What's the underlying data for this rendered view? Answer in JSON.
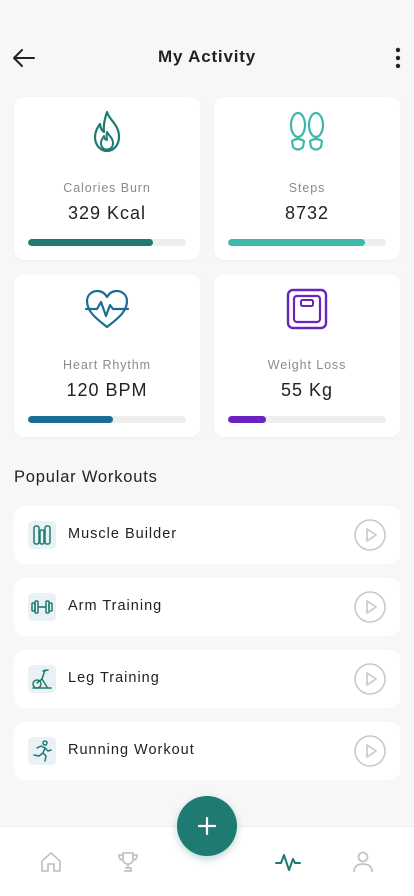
{
  "header": {
    "title": "My Activity",
    "back_icon": "arrow-left-icon",
    "menu_icon": "more-vertical-icon"
  },
  "stats": [
    {
      "label": "Calories Burn",
      "value": "329 Kcal",
      "icon": "flame-icon",
      "progress": 0.79,
      "color": "#1f7a72"
    },
    {
      "label": "Steps",
      "value": "8732",
      "icon": "footprints-icon",
      "progress": 0.87,
      "color": "#3fb8aa"
    },
    {
      "label": "Heart Rhythm",
      "value": "120 BPM",
      "icon": "heart-pulse-icon",
      "progress": 0.54,
      "color": "#1a6e94"
    },
    {
      "label": "Weight Loss",
      "value": "55 Kg",
      "icon": "scale-icon",
      "progress": 0.24,
      "color": "#6a22c0"
    }
  ],
  "section": {
    "title": "Popular Workouts"
  },
  "workouts": [
    {
      "label": "Muscle Builder",
      "icon": "muscle-builder-icon"
    },
    {
      "label": "Arm Training",
      "icon": "dumbbell-icon"
    },
    {
      "label": "Leg Training",
      "icon": "exercise-bike-icon"
    },
    {
      "label": "Running Workout",
      "icon": "runner-icon"
    }
  ],
  "nav": {
    "items": [
      "home-icon",
      "trophy-icon",
      "add-icon",
      "activity-icon",
      "profile-icon"
    ],
    "active": "activity-icon",
    "accent": "#1f7a72",
    "inactive_color": "#c4c4c4"
  }
}
